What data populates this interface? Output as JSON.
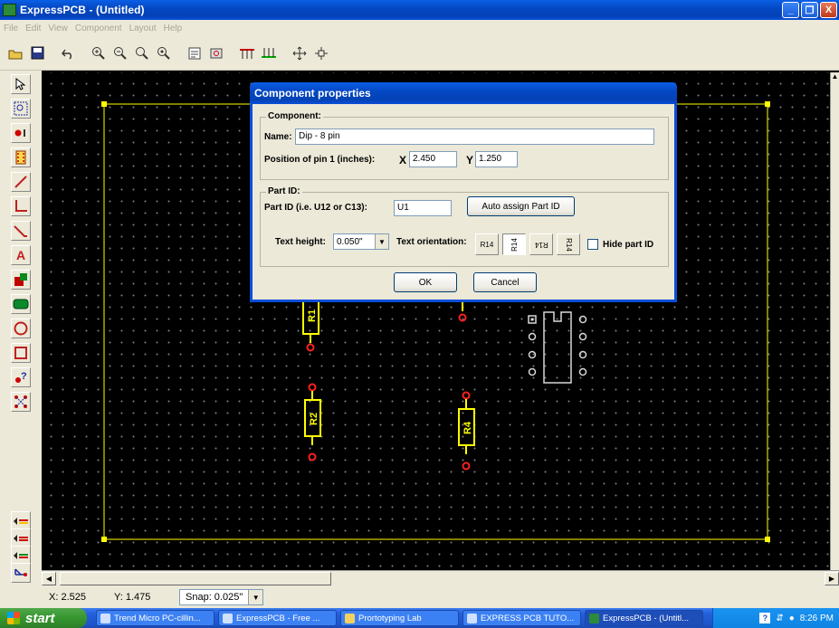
{
  "app": {
    "title": "ExpressPCB - (Untitled)"
  },
  "window_controls": {
    "minimize": "_",
    "restore": "❐",
    "close": "X"
  },
  "menu": [
    "File",
    "Edit",
    "View",
    "Component",
    "Layout",
    "Help"
  ],
  "toolbar": {
    "buttons": [
      "open-icon",
      "save-icon",
      "undo-icon",
      "zoom-in-icon",
      "zoom-out-icon",
      "zoom-fit-icon",
      "zoom-prev-icon",
      "properties-icon",
      "pad-icon",
      "top-layer-icon",
      "bottom-layer-icon",
      "move-icon",
      "move-all-icon"
    ]
  },
  "palette": {
    "tools": [
      "select-arrow-icon",
      "zoom-region-icon",
      "place-pad-icon",
      "place-component-icon",
      "trace-icon",
      "trace-corner-icon",
      "trace-diagonal-icon",
      "text-icon",
      "filled-rect-icon",
      "ground-plane-icon",
      "circle-icon",
      "rectangle-icon",
      "query-pad-icon",
      "connect-icon"
    ],
    "layer_tools": [
      "layer-top-icon",
      "layer-bottom-icon",
      "layer-silk-icon",
      "layer-select-icon"
    ]
  },
  "canvas": {
    "components": [
      {
        "label": "R1",
        "kind": "resistor"
      },
      {
        "label": "R2",
        "kind": "resistor"
      },
      {
        "label": "R4",
        "kind": "resistor"
      },
      {
        "label": "",
        "kind": "dip-8"
      }
    ]
  },
  "dialog": {
    "title": "Component properties",
    "component_group": "Component:",
    "name_label": "Name:",
    "name_value": "Dip - 8 pin",
    "position_label": "Position of pin 1 (inches):",
    "x_label": "X",
    "x_value": "2.450",
    "y_label": "Y",
    "y_value": "1.250",
    "partid_group": "Part ID:",
    "partid_label": "Part ID (i.e. U12 or C13):",
    "partid_value": "U1",
    "auto_assign_label": "Auto assign Part ID",
    "text_height_label": "Text height:",
    "text_height_value": "0.050\"",
    "text_orientation_label": "Text orientation:",
    "orientations": [
      "R14",
      "R14",
      "R14",
      "R14"
    ],
    "hide_part_id_label": "Hide part ID",
    "ok_label": "OK",
    "cancel_label": "Cancel"
  },
  "status": {
    "x": "X: 2.525",
    "y": "Y: 1.475",
    "snap": "Snap: 0.025\""
  },
  "taskbar": {
    "start_label": "start",
    "tasks": [
      "Trend Micro PC-cillin...",
      "ExpressPCB - Free ...",
      "Prortotyping Lab",
      "EXPRESS PCB TUTO...",
      "ExpressPCB - (Untitl..."
    ],
    "clock": "8:26 PM"
  },
  "colors": {
    "board_outline": "#ffff00",
    "component_outline": "#ffff00",
    "pad": "#ff2020",
    "dip_outline": "#d8d8d8",
    "accent": "#0a4fd8"
  }
}
